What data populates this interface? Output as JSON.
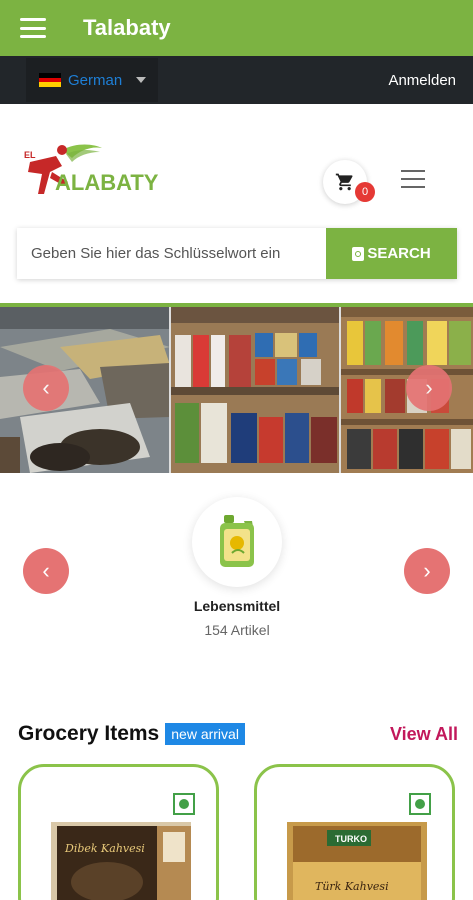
{
  "app": {
    "title": "Talabaty"
  },
  "topbar": {
    "language": "German",
    "login": "Anmelden"
  },
  "header": {
    "logo_text": "ALABATY",
    "cart_count": "0"
  },
  "search": {
    "placeholder": "Geben Sie hier das Schlüsselwort ein",
    "button": "SEARCH"
  },
  "category": {
    "name": "Lebensmittel",
    "count": "154 Artikel"
  },
  "section": {
    "title": "Grocery Items",
    "badge": "new arrival",
    "view_all": "View All"
  },
  "products": [
    {
      "label": "Dibek Kahvesi"
    },
    {
      "label": "Türk Kahvesi"
    }
  ],
  "colors": {
    "primary": "#7cb342",
    "arrow": "#e57373",
    "badge": "#1e88e5",
    "link": "#c2185b",
    "cart_badge": "#e53935"
  }
}
